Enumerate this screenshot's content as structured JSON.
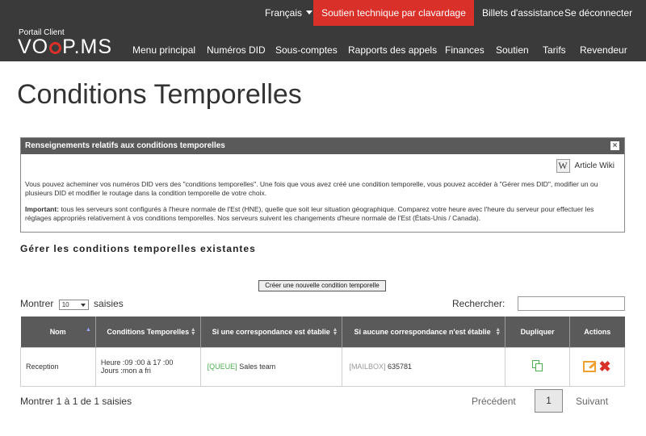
{
  "header": {
    "language": "Français",
    "chat_support": "Soutien technique par clavardage",
    "tickets": "Billets d'assistance",
    "logout": "Se déconnecter",
    "logo_caption": "Portail Client",
    "logo_text_a": "VO",
    "logo_text_b": "P.MS",
    "accent_color": "#d9302a"
  },
  "nav": {
    "items": [
      "Menu principal",
      "Numéros DID",
      "Sous-comptes",
      "Rapports des appels",
      "Finances",
      "Soutien",
      "Tarifs",
      "Revendeur"
    ]
  },
  "page_title": "Conditions Temporelles",
  "info_panel": {
    "title": "Renseignements relatifs aux conditions temporelles",
    "close": "×",
    "wiki_label": "Article Wiki",
    "wiki_icon": "W",
    "paragraph1": "Vous pouvez acheminer vos numéros DID vers des \"conditions temporelles\". Une fois que vous avez créé une condition temporelle, vous pouvez accéder à \"Gérer mes DID\", modifier un ou plusieurs DID et modifier le routage dans la condition temporelle de votre choix.",
    "important_label": "Important:",
    "paragraph2": " tous les serveurs sont configurés à l'heure normale de l'Est (HNE), quelle que soit leur situation géographique. Comparez votre heure avec l'heure du serveur pour effectuer les réglages appropriés relativement à vos conditions temporelles. Nos serveurs suivent les changements d'heure normale de l'Est (États-Unis / Canada)."
  },
  "section_title": "Gérer les conditions temporelles existantes",
  "create_button": "Créer une nouvelle condition temporelle",
  "table_controls": {
    "show_prefix": "Montrer",
    "show_value": "10",
    "show_suffix": "saisies",
    "search_label": "Rechercher:"
  },
  "table": {
    "columns": [
      "Nom",
      "Conditions Temporelles",
      "Si une correspondance est établie",
      "Si aucune correspondance n'est établie",
      "Dupliquer",
      "Actions"
    ],
    "rows": [
      {
        "name": "Reception",
        "hours": "Heure :09 :00 à 17 :00",
        "days": "Jours :mon a fri",
        "match_tag": "[QUEUE]",
        "match_target": "Sales team",
        "nomatch_tag": "[MAILBOX]",
        "nomatch_target": "635781"
      }
    ]
  },
  "footer": {
    "summary": "Montrer 1 à 1 de 1 saisies",
    "previous": "Précédent",
    "page": "1",
    "next": "Suivant"
  }
}
